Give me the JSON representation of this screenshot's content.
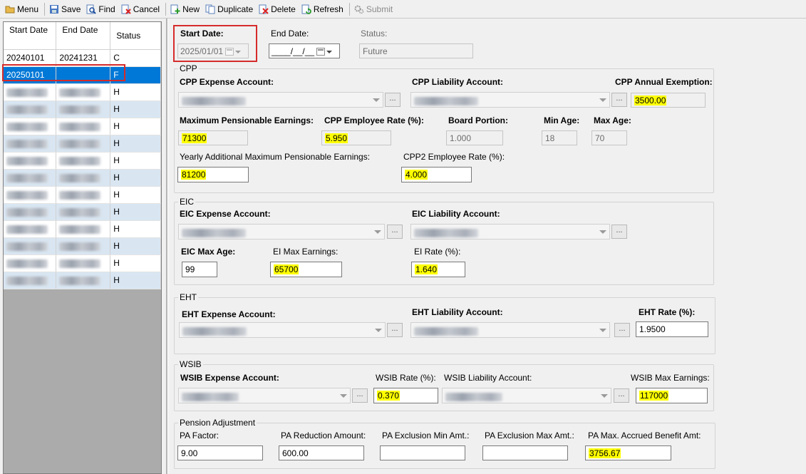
{
  "toolbar": {
    "menu": "Menu",
    "save": "Save",
    "find": "Find",
    "cancel": "Cancel",
    "new": "New",
    "duplicate": "Duplicate",
    "delete": "Delete",
    "refresh": "Refresh",
    "submit": "Submit"
  },
  "grid": {
    "headers": {
      "start": "Start Date",
      "end": "End Date",
      "status": "Status"
    },
    "rows": [
      {
        "start": "20240101",
        "end": "20241231",
        "status": "C"
      },
      {
        "start": "20250101",
        "end": "",
        "status": "F"
      },
      {
        "status": "H"
      },
      {
        "status": "H"
      },
      {
        "status": "H"
      },
      {
        "status": "H"
      },
      {
        "status": "H"
      },
      {
        "status": "H"
      },
      {
        "status": "H"
      },
      {
        "status": "H"
      },
      {
        "status": "H"
      },
      {
        "status": "H"
      },
      {
        "status": "H"
      },
      {
        "status": "H"
      }
    ]
  },
  "header": {
    "start_date_label": "Start Date:",
    "start_date_value": "2025/01/01",
    "end_date_label": "End Date:",
    "end_date_value": "____/__/__",
    "status_label": "Status:",
    "status_value": "Future"
  },
  "cpp": {
    "title": "CPP",
    "expense_label": "CPP Expense Account:",
    "liability_label": "CPP Liability Account:",
    "annual_exemption_label": "CPP Annual Exemption:",
    "annual_exemption": "3500.00",
    "max_pensionable_label": "Maximum Pensionable Earnings:",
    "max_pensionable": "71300",
    "employee_rate_label": "CPP Employee Rate (%):",
    "employee_rate": "5.950",
    "board_portion_label": "Board Portion:",
    "board_portion": "1.000",
    "min_age_label": "Min Age:",
    "min_age": "18",
    "max_age_label": "Max Age:",
    "max_age": "70",
    "yampe_label": "Yearly Additional Maximum Pensionable Earnings:",
    "yampe": "81200",
    "cpp2_rate_label": "CPP2 Employee Rate (%):",
    "cpp2_rate": "4.000"
  },
  "eic": {
    "title": "EIC",
    "expense_label": "EIC Expense Account:",
    "liability_label": "EIC Liability Account:",
    "max_age_label": "EIC Max Age:",
    "max_age": "99",
    "max_earnings_label": "EI Max Earnings:",
    "max_earnings": "65700",
    "rate_label": "EI Rate (%):",
    "rate": "1.640"
  },
  "eht": {
    "title": "EHT",
    "expense_label": "EHT Expense Account:",
    "liability_label": "EHT Liability Account:",
    "rate_label": "EHT Rate (%):",
    "rate": "1.9500"
  },
  "wsib": {
    "title": "WSIB",
    "expense_label": "WSIB Expense Account:",
    "rate_label": "WSIB Rate (%):",
    "rate": "0.370",
    "liability_label": "WSIB Liability Account:",
    "max_earnings_label": "WSIB Max Earnings:",
    "max_earnings": "117000"
  },
  "pension": {
    "title": "Pension Adjustment",
    "factor_label": "PA Factor:",
    "factor": "9.00",
    "reduction_label": "PA Reduction Amount:",
    "reduction": "600.00",
    "excl_min_label": "PA Exclusion Min Amt.:",
    "excl_min": "",
    "excl_max_label": "PA Exclusion Max Amt.:",
    "excl_max": "",
    "max_accrued_label": "PA Max. Accrued Benefit Amt:",
    "max_accrued": "3756.67"
  },
  "colors": {
    "selection": "#0078d7",
    "highlight": "#ffff00",
    "annotation": "#d62b2b",
    "alt_row": "#d9e6f2"
  }
}
